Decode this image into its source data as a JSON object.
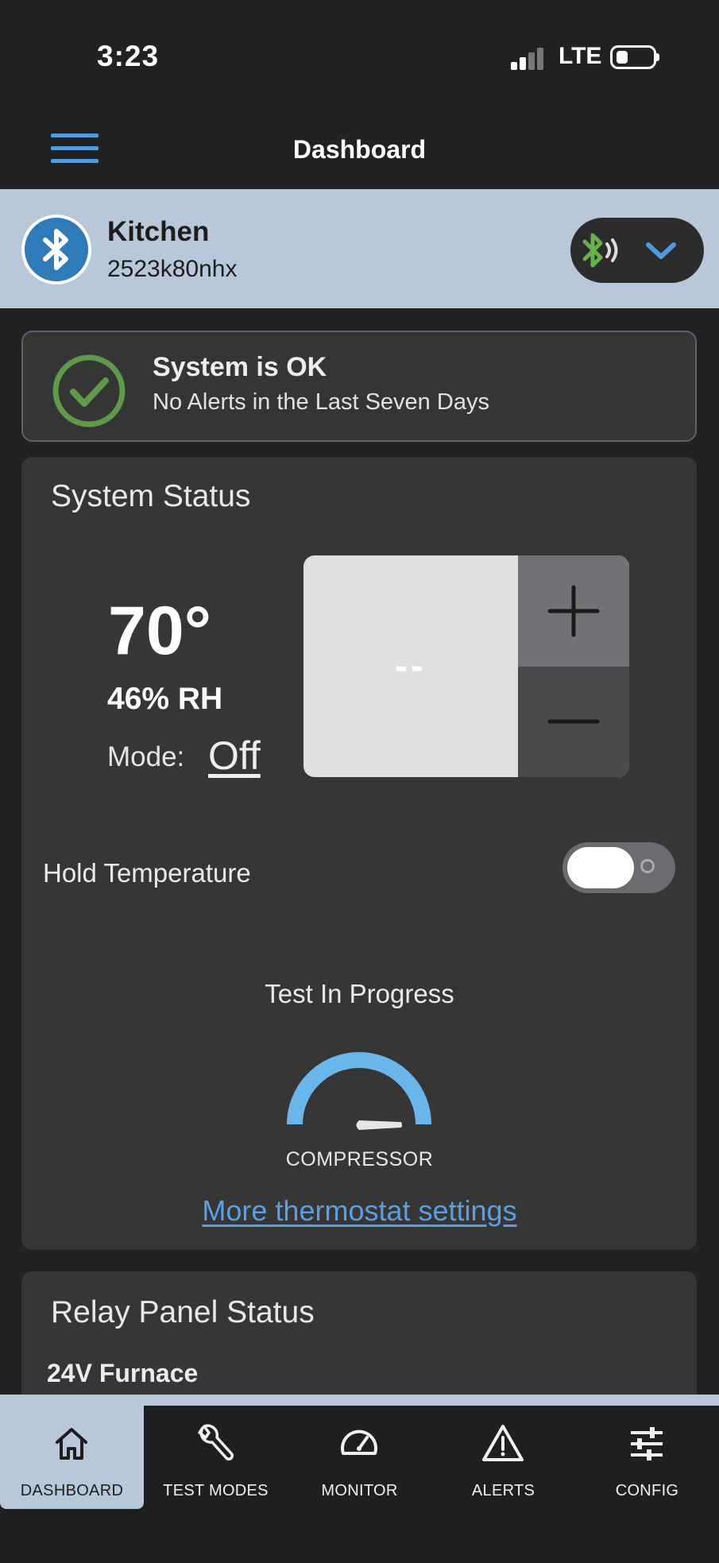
{
  "status_bar": {
    "time": "3:23",
    "network": "LTE"
  },
  "header": {
    "title": "Dashboard",
    "menu_icon": "hamburger-menu-icon"
  },
  "device": {
    "name": "Kitchen",
    "id": "2523k80nhx",
    "icon": "bluetooth-icon",
    "connection_icon": "bluetooth-signal-icon"
  },
  "system_ok": {
    "title": "System is OK",
    "subtitle": "No Alerts in the Last Seven Days",
    "icon": "check-circle-icon"
  },
  "system_status": {
    "title": "System Status",
    "temperature": "70°",
    "humidity": "46% RH",
    "mode_label": "Mode:",
    "mode_value": "Off",
    "setpoint": "--",
    "hold_label": "Hold Temperature",
    "hold_on": false,
    "test_status": "Test In Progress",
    "gauge_label": "COMPRESSOR",
    "more_link": "More thermostat settings"
  },
  "relay_panel": {
    "title": "Relay Panel Status",
    "first_item": "24V Furnace"
  },
  "nav": [
    {
      "label": "DASHBOARD",
      "icon": "home-icon",
      "active": true
    },
    {
      "label": "TEST MODES",
      "icon": "wrench-icon",
      "active": false
    },
    {
      "label": "MONITOR",
      "icon": "speedometer-icon",
      "active": false
    },
    {
      "label": "ALERTS",
      "icon": "warning-icon",
      "active": false
    },
    {
      "label": "CONFIG",
      "icon": "sliders-icon",
      "active": false
    }
  ],
  "colors": {
    "accent_blue": "#4f9be0",
    "bluetooth_blue": "#2f7ab8",
    "ok_green": "#5f9a4b",
    "device_bar": "#b9c8d9",
    "card_bg": "#363636",
    "page_bg": "#222222"
  }
}
